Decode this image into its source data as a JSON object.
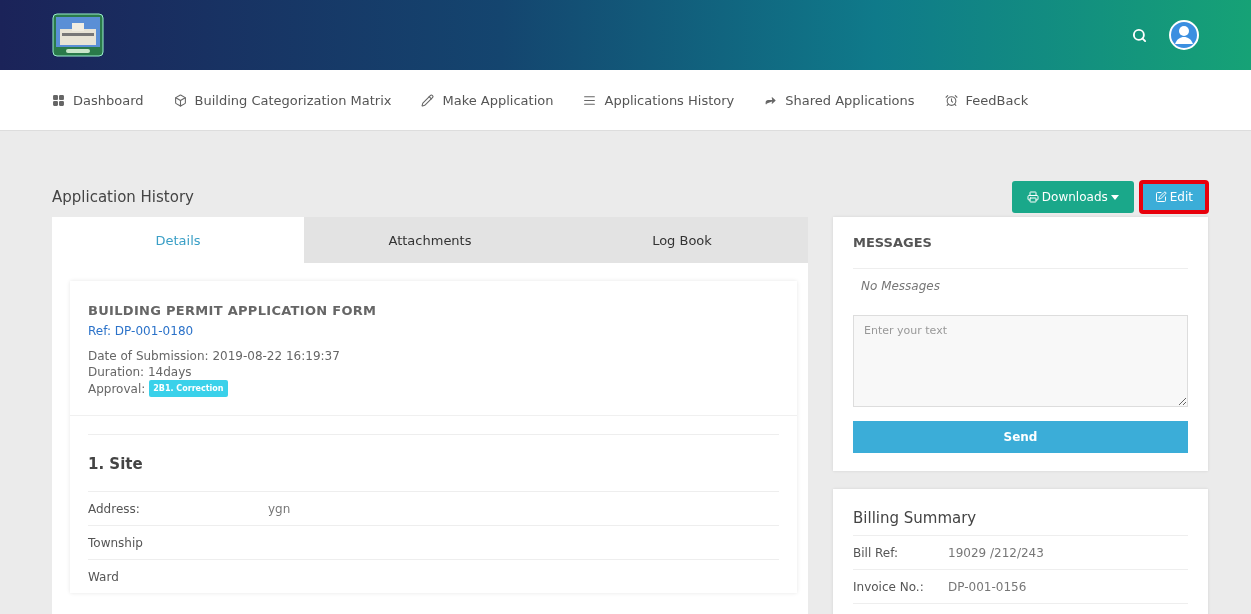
{
  "nav": [
    {
      "label": "Dashboard",
      "selected": false
    },
    {
      "label": "Building Categorization Matrix",
      "selected": false
    },
    {
      "label": "Make Application",
      "selected": false
    },
    {
      "label": "Applications History",
      "selected": false
    },
    {
      "label": "Shared Applications",
      "selected": false
    },
    {
      "label": "FeedBack",
      "selected": false
    }
  ],
  "page_title": "Application History",
  "actions": [
    {
      "label": "Downloads",
      "kind": "dropdown",
      "highlighted": false
    },
    {
      "label": "Edit",
      "kind": "edit",
      "highlighted": true
    }
  ],
  "tabs": [
    {
      "label": "Details",
      "selected": true
    },
    {
      "label": "Attachments",
      "selected": false
    },
    {
      "label": "Log Book",
      "selected": false
    }
  ],
  "form": {
    "title": "BUILDING PERMIT APPLICATION FORM",
    "ref": "Ref: DP-001-0180",
    "lines": [
      "Date of Submission: 2019-08-22 16:19:37",
      "Duration: 14days"
    ],
    "approval_label": "Approval:",
    "approval_badge": "2B1. Correction"
  },
  "site": {
    "heading": "1. Site",
    "rows": [
      {
        "label": "Address:",
        "value": "ygn"
      },
      {
        "label": "Township"
      },
      {
        "label": "Ward"
      }
    ]
  },
  "messages": {
    "title": "MESSAGES",
    "empty": "No Messages",
    "placeholder": "Enter your text",
    "button": "Send"
  },
  "billing": {
    "title": "Billing Summary",
    "rows": [
      {
        "label": "Bill Ref:",
        "value": "19029 /212/243"
      },
      {
        "label": "Invoice No.:",
        "value": "DP-001-0156"
      }
    ]
  }
}
